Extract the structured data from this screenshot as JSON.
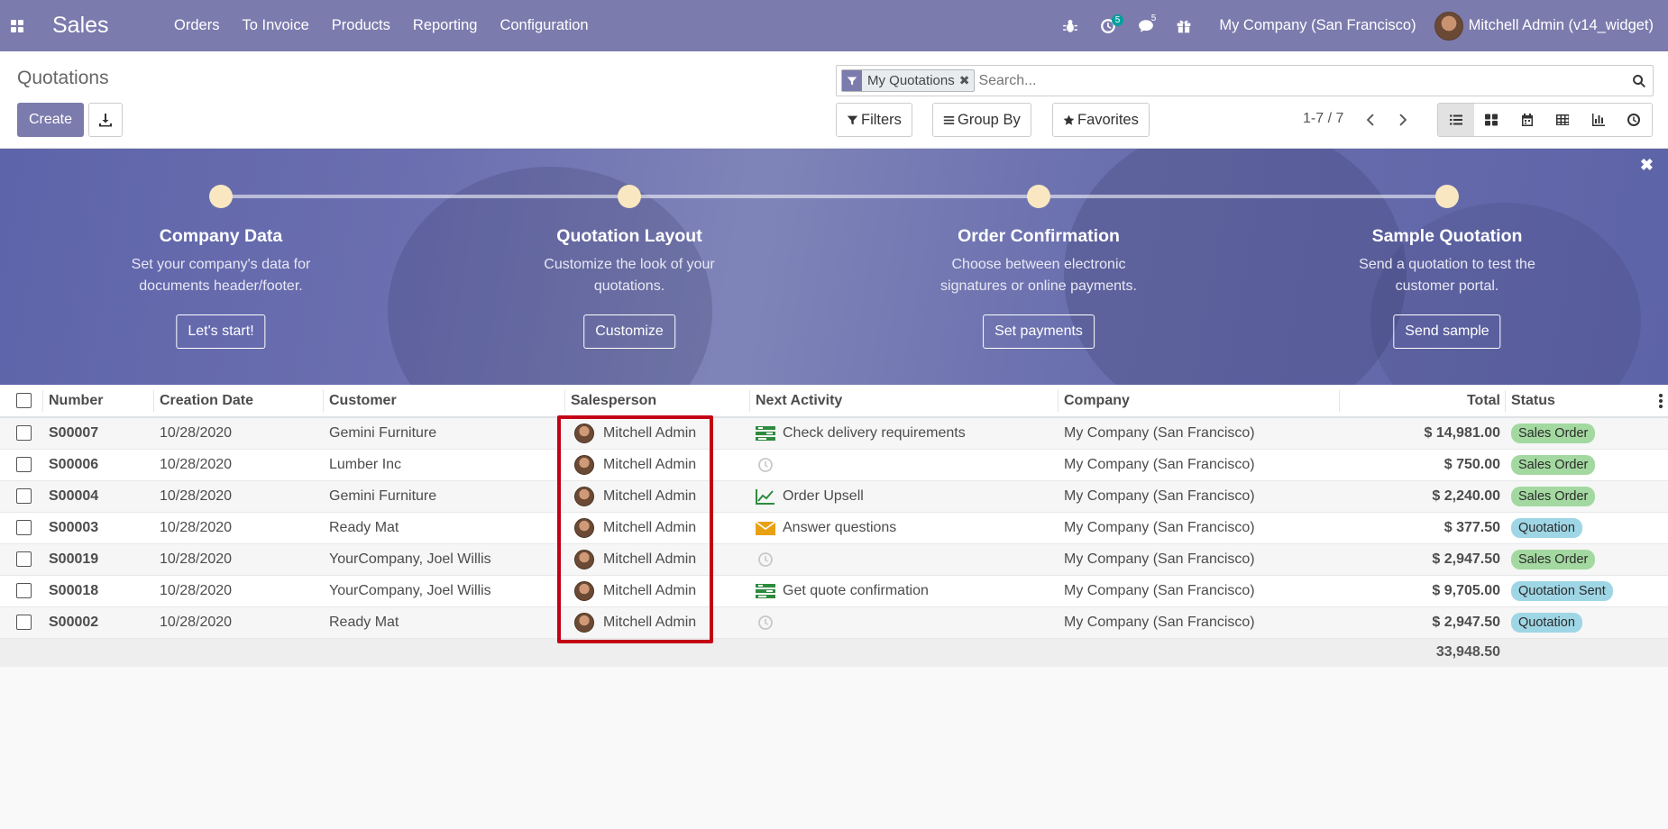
{
  "navbar": {
    "app_name": "Sales",
    "menu": [
      "Orders",
      "To Invoice",
      "Products",
      "Reporting",
      "Configuration"
    ],
    "activity_count": "5",
    "message_count": "5",
    "company": "My Company (San Francisco)",
    "user": "Mitchell Admin (v14_widget)",
    "icons": [
      "apps-grid-icon",
      "bug-icon",
      "activity-clock-icon",
      "chat-icon",
      "gift-icon"
    ]
  },
  "control": {
    "title": "Quotations",
    "create_label": "Create",
    "search_facet": "My Quotations",
    "search_placeholder": "Search...",
    "filters_label": "Filters",
    "groupby_label": "Group By",
    "favorites_label": "Favorites",
    "pager": "1-7 / 7",
    "active_view": "list"
  },
  "banner": {
    "steps": [
      {
        "title": "Company Data",
        "desc": "Set your company's data for documents header/footer.",
        "button": "Let's start!"
      },
      {
        "title": "Quotation Layout",
        "desc": "Customize the look of your quotations.",
        "button": "Customize"
      },
      {
        "title": "Order Confirmation",
        "desc": "Choose between electronic signatures or online payments.",
        "button": "Set payments"
      },
      {
        "title": "Sample Quotation",
        "desc": "Send a quotation to test the customer portal.",
        "button": "Send sample"
      }
    ]
  },
  "table": {
    "columns": [
      "Number",
      "Creation Date",
      "Customer",
      "Salesperson",
      "Next Activity",
      "Company",
      "Total",
      "Status"
    ],
    "rows": [
      {
        "number": "S00007",
        "date": "10/28/2020",
        "customer": "Gemini Furniture",
        "salesperson": "Mitchell Admin",
        "activity": "Check delivery requirements",
        "activity_icon": "tasks-icon",
        "company": "My Company (San Francisco)",
        "total": "$ 14,981.00",
        "status": "Sales Order"
      },
      {
        "number": "S00006",
        "date": "10/28/2020",
        "customer": "Lumber Inc",
        "salesperson": "Mitchell Admin",
        "activity": "",
        "activity_icon": "clock-icon",
        "company": "My Company (San Francisco)",
        "total": "$ 750.00",
        "status": "Sales Order"
      },
      {
        "number": "S00004",
        "date": "10/28/2020",
        "customer": "Gemini Furniture",
        "salesperson": "Mitchell Admin",
        "activity": "Order Upsell",
        "activity_icon": "line-chart-icon",
        "company": "My Company (San Francisco)",
        "total": "$ 2,240.00",
        "status": "Sales Order"
      },
      {
        "number": "S00003",
        "date": "10/28/2020",
        "customer": "Ready Mat",
        "salesperson": "Mitchell Admin",
        "activity": "Answer questions",
        "activity_icon": "envelope-icon",
        "company": "My Company (San Francisco)",
        "total": "$ 377.50",
        "status": "Quotation"
      },
      {
        "number": "S00019",
        "date": "10/28/2020",
        "customer": "YourCompany, Joel Willis",
        "salesperson": "Mitchell Admin",
        "activity": "",
        "activity_icon": "clock-icon",
        "company": "My Company (San Francisco)",
        "total": "$ 2,947.50",
        "status": "Sales Order"
      },
      {
        "number": "S00018",
        "date": "10/28/2020",
        "customer": "YourCompany, Joel Willis",
        "salesperson": "Mitchell Admin",
        "activity": "Get quote confirmation",
        "activity_icon": "tasks-icon",
        "company": "My Company (San Francisco)",
        "total": "$ 9,705.00",
        "status": "Quotation Sent"
      },
      {
        "number": "S00002",
        "date": "10/28/2020",
        "customer": "Ready Mat",
        "salesperson": "Mitchell Admin",
        "activity": "",
        "activity_icon": "clock-icon",
        "company": "My Company (San Francisco)",
        "total": "$ 2,947.50",
        "status": "Quotation"
      }
    ],
    "grand_total": "33,948.50"
  },
  "colors": {
    "brand": "#7c7bad",
    "status_sales_order": "#a3d9a0",
    "status_quotation": "#9fd6e6",
    "status_quotation_sent": "#9fd6e6",
    "highlight": "#c40015",
    "activity_green": "#2e8b3e",
    "activity_orange": "#e9a114"
  }
}
